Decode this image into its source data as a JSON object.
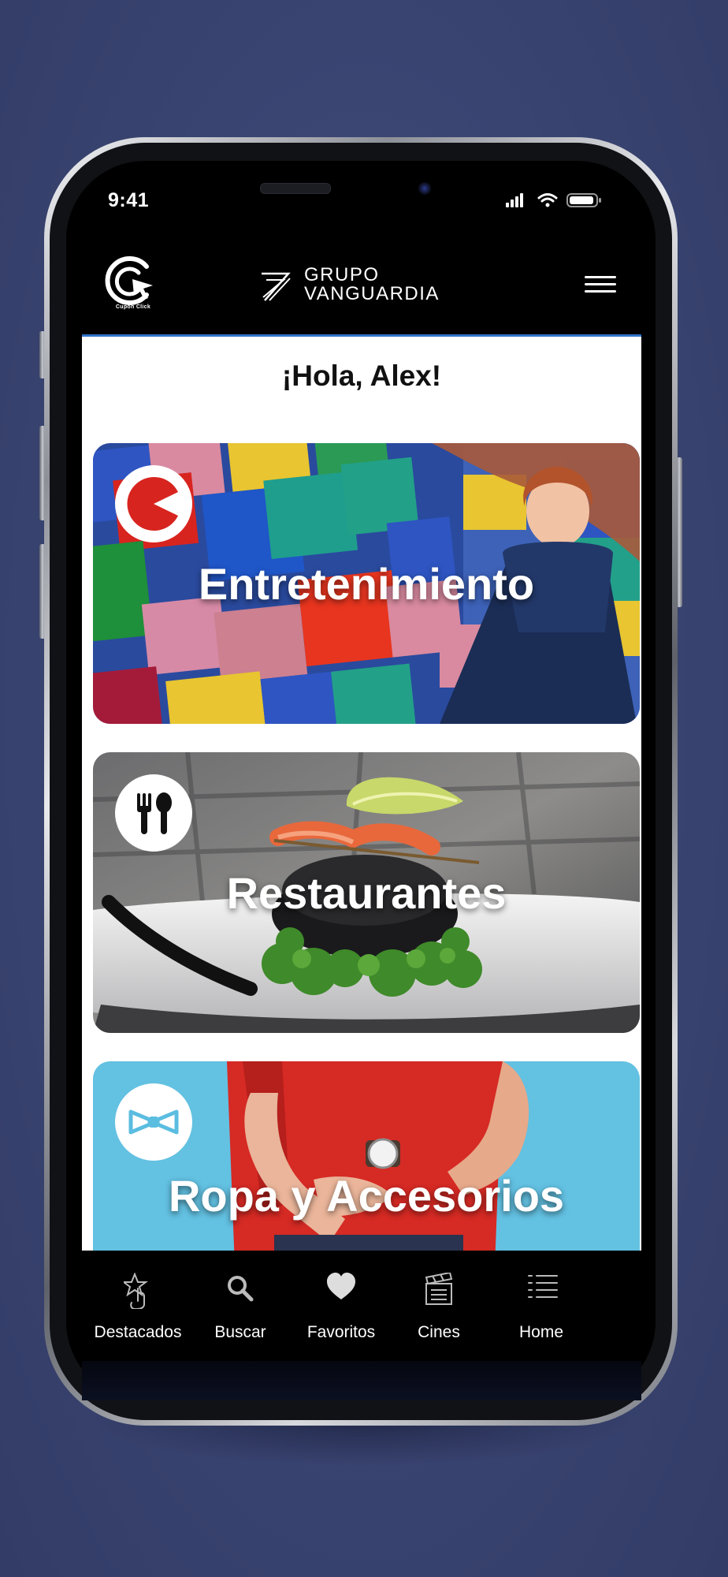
{
  "status_bar": {
    "time": "9:41"
  },
  "header": {
    "app_logo_text": "Cupón Click",
    "brand_line1": "GRUPO",
    "brand_line2": "VANGUARDIA"
  },
  "greeting": "¡Hola, Alex!",
  "categories": [
    {
      "title": "Entretenimiento",
      "icon": "pacman-icon"
    },
    {
      "title": "Restaurantes",
      "icon": "fork-spoon-icon"
    },
    {
      "title": "Ropa y Accesorios",
      "icon": "bow-tie-icon"
    }
  ],
  "tabbar": [
    {
      "label": "Destacados",
      "icon": "star-tap-icon"
    },
    {
      "label": "Buscar",
      "icon": "search-icon"
    },
    {
      "label": "Favoritos",
      "icon": "heart-icon"
    },
    {
      "label": "Cines",
      "icon": "clapperboard-icon"
    },
    {
      "label": "Home",
      "icon": "list-icon"
    }
  ],
  "colors": {
    "background": "#3a4471",
    "header": "#000000",
    "accent_line": "#2e73c9",
    "brand_red": "#d8241f"
  }
}
